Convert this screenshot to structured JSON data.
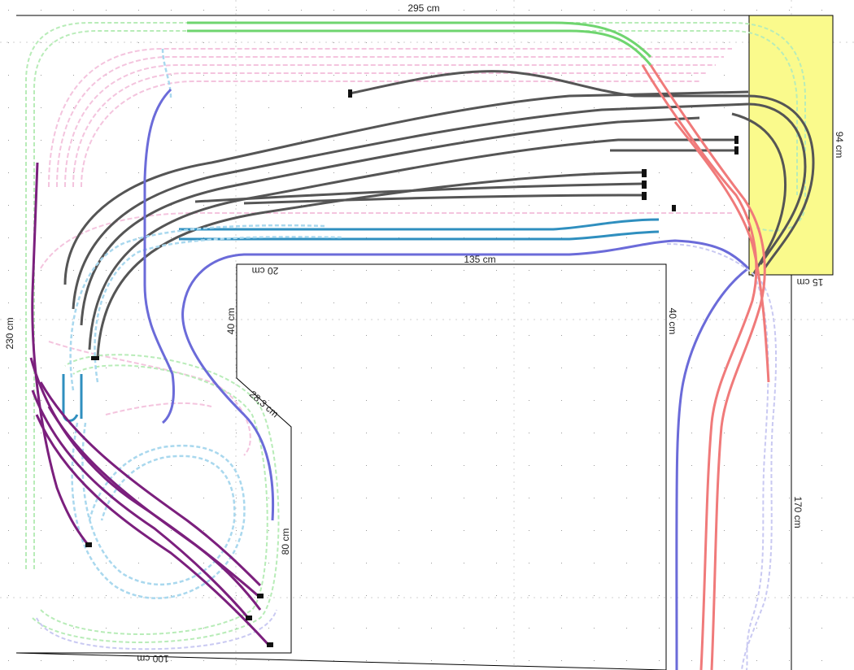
{
  "dimensions": {
    "top": "295 cm",
    "left": "230 cm",
    "yellow_height": "94 cm",
    "yellow_width": "15 cm",
    "mid_top": "135 cm",
    "inner_left_top": "20 cm",
    "inner_left_side": "40 cm",
    "inner_right_side": "40 cm",
    "diagonal": "28,3 cm",
    "left_module_right": "80 cm",
    "left_module_bottom": "100 cm",
    "right_leg": "170 cm"
  },
  "colors": {
    "grid_dot": "#9a9a9a",
    "guide_line": "#d0d0d0",
    "outline": "#000000",
    "yellow_board": "#fafa8c",
    "green_track": "#6fd56f",
    "light_green_track": "#b8ecb8",
    "gray_track": "#555555",
    "pink_track": "#f4c4de",
    "blue_track": "#2f8fbf",
    "light_blue_track": "#a9d8ee",
    "purple_track": "#7b1f7d",
    "violet_track": "#6b6bd9",
    "lavender_track": "#c9c9f2",
    "red_track": "#f07a7a",
    "buffer": "#111111"
  }
}
